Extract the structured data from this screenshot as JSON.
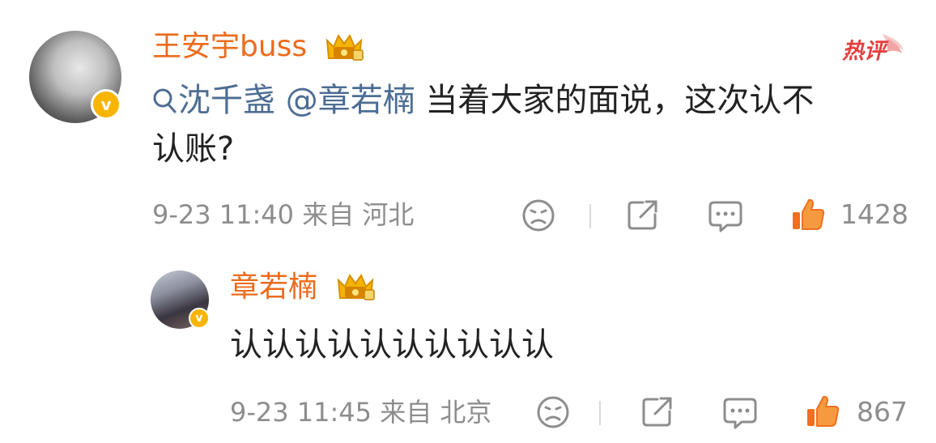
{
  "comment": {
    "username": "王安宇buss",
    "badge": "热评",
    "mentions": [
      "沈千盏",
      "@章若楠"
    ],
    "text_line1": " 当着大家的面说，这次认不",
    "text_line2": "认账?",
    "time": "9-23 11:40",
    "source": "来自 河北",
    "like_count": "1428",
    "verified_icon": "v-badge-icon"
  },
  "reply": {
    "username": "章若楠",
    "text": "认认认认认认认认认认",
    "time": "9-23 11:45",
    "source": "来自 北京",
    "like_count": "867"
  },
  "colors": {
    "username": "#ec6b1c",
    "link": "#4d6d94",
    "meta": "#8d8d8d",
    "hot_badge": "#e53e3e",
    "like": "#f07020"
  }
}
